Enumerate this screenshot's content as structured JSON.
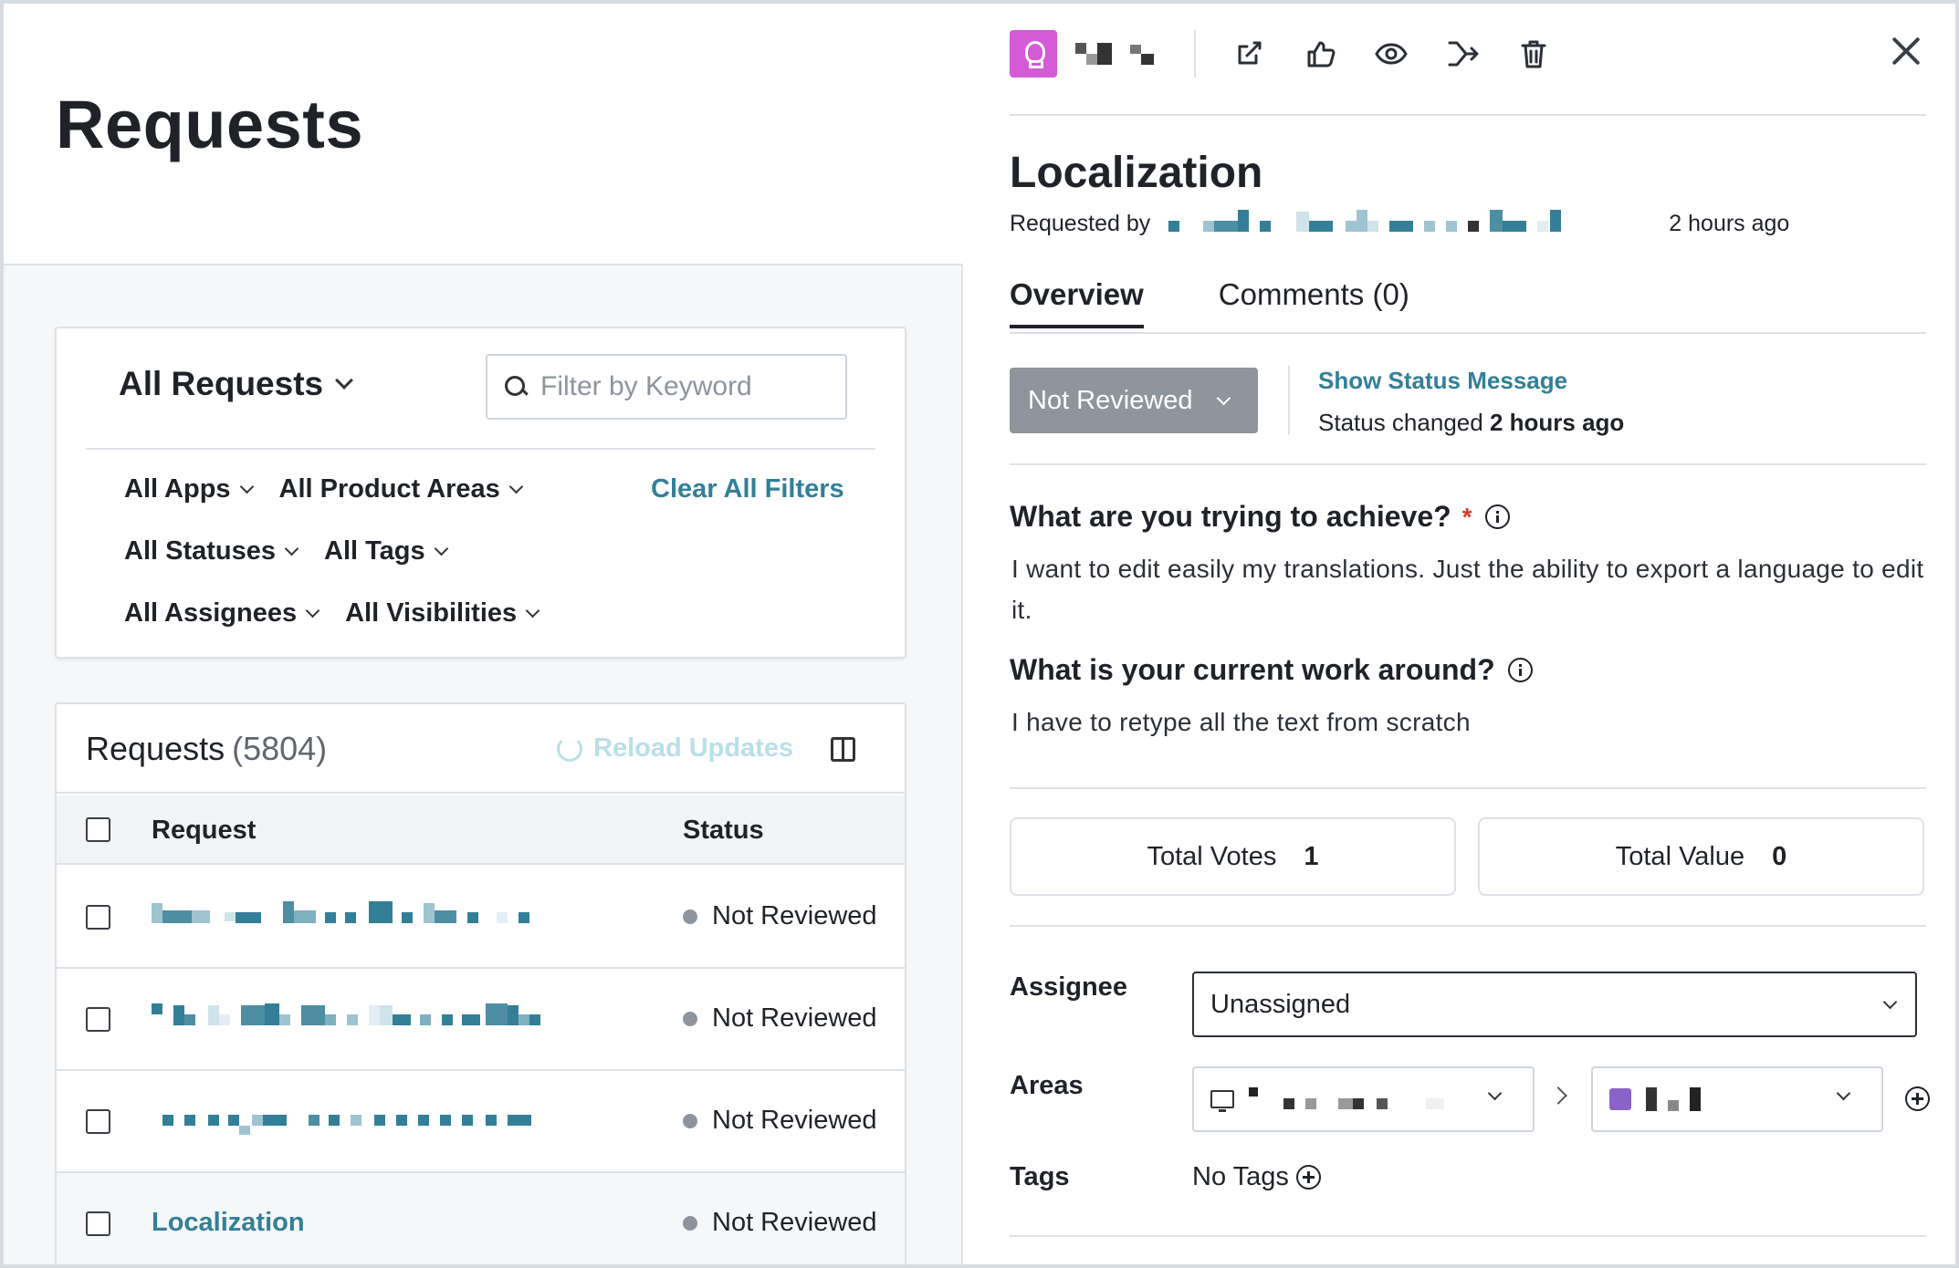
{
  "left": {
    "page_title": "Requests",
    "filters": {
      "scope_label": "All Requests",
      "keyword_placeholder": "Filter by Keyword",
      "apps": "All Apps",
      "product_areas": "All Product Areas",
      "statuses": "All Statuses",
      "tags": "All Tags",
      "assignees": "All Assignees",
      "visibilities": "All Visibilities",
      "clear_all": "Clear All Filters"
    },
    "list": {
      "title": "Requests",
      "count": "(5804)",
      "reload_label": "Reload Updates",
      "columns": {
        "request": "Request",
        "status": "Status"
      },
      "rows": [
        {
          "request": "",
          "status": "Not Reviewed"
        },
        {
          "request": "",
          "status": "Not Reviewed"
        },
        {
          "request": "",
          "status": "Not Reviewed"
        },
        {
          "request": "Localization",
          "status": "Not Reviewed"
        }
      ]
    }
  },
  "detail": {
    "title": "Localization",
    "requested_by_label": "Requested by",
    "requested_ago": "2 hours ago",
    "tabs": {
      "overview": "Overview",
      "comments": "Comments (0)"
    },
    "status": {
      "current": "Not Reviewed",
      "show_message": "Show Status Message",
      "changed_prefix": "Status changed",
      "changed_when": "2 hours ago"
    },
    "questions": [
      {
        "question": "What are you trying to achieve?",
        "required_mark": "*",
        "answer": "I want to edit easily my translations. Just the ability to export a language to edit it."
      },
      {
        "question": "What is your current work around?",
        "answer": "I have to retype all the text from scratch"
      }
    ],
    "totals": {
      "votes_label": "Total Votes",
      "votes": "1",
      "value_label": "Total Value",
      "value": "0"
    },
    "fields": {
      "assignee_label": "Assignee",
      "assignee_value": "Unassigned",
      "areas_label": "Areas",
      "tags_label": "Tags",
      "tags_value": "No Tags"
    },
    "colors": {
      "accent_teal": "#337f98",
      "idea_badge": "#d45ad6",
      "status_gray": "#8e959c",
      "area_swatch": "#8a63c9",
      "required_red": "#d33b2c"
    },
    "icons": [
      "lightbulb-icon",
      "external-link-icon",
      "thumbs-up-icon",
      "eye-icon",
      "merge-icon",
      "trash-icon",
      "close-icon",
      "info-icon",
      "monitor-icon",
      "plus-circle-icon"
    ]
  }
}
